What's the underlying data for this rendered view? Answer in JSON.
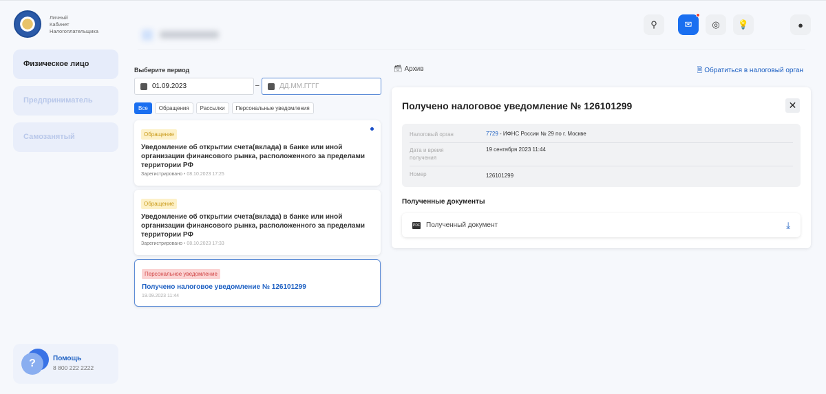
{
  "header": {
    "logo_text": [
      "Личный",
      "Кабинет",
      "Налогоплательщика"
    ]
  },
  "sidebar": {
    "items": [
      {
        "label": "Физическое лицо"
      },
      {
        "label": "Предприниматель"
      },
      {
        "label": "Самозанятый"
      }
    ],
    "help": {
      "label": "Помощь",
      "phone": "8 800 222 2222"
    }
  },
  "filters": {
    "period_label": "Выберите период",
    "date_from": "01.09.2023",
    "date_to_placeholder": "ДД.ММ.ГГГГ",
    "separator": "–",
    "chips": [
      "Все",
      "Обращения",
      "Рассылки",
      "Персональные уведомления"
    ]
  },
  "messages": [
    {
      "badge": "Обращение",
      "title": "Уведомление об открытии счета(вклада) в банке или иной организации финансового рынка, расположенного за пределами территории РФ",
      "status": "Зарегистрировано",
      "date": "08.10.2023 17:25",
      "unread": true
    },
    {
      "badge": "Обращение",
      "title": "Уведомление об открытии счета(вклада) в банке или иной организации финансового рынка, расположенного за пределами территории РФ",
      "status": "Зарегистрировано",
      "date": "08.10.2023 17:33"
    },
    {
      "badge": "Персональное уведомление",
      "title": "Получено налоговое уведомление № 126101299",
      "date": "19.09.2023 11:44"
    }
  ],
  "actions": {
    "archive": "Архив",
    "contact": "Обратиться в налоговый орган"
  },
  "detail": {
    "title": "Получено налоговое уведомление № 126101299",
    "close": "✕",
    "rows": [
      {
        "key": "Налоговый орган",
        "code": "7729",
        "value": " - ИФНС России № 29 по г. Москве"
      },
      {
        "key": "Дата и время получения",
        "value": "19 сентября 2023 11:44"
      },
      {
        "key": "Номер",
        "value": "126101299"
      }
    ],
    "docs_heading": "Полученные документы",
    "doc_name": "Полученный документ",
    "pdf": "PDF"
  },
  "colors": {
    "accent": "#1a6ff0",
    "link": "#1c5fc2"
  }
}
